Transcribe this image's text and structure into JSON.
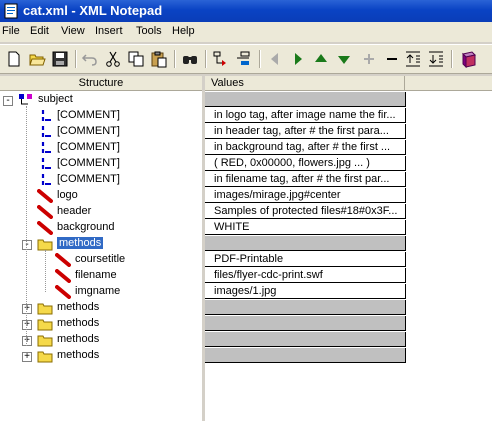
{
  "window": {
    "title": "cat.xml - XML Notepad"
  },
  "menu": [
    "File",
    "Edit",
    "View",
    "Insert",
    "Tools",
    "Help"
  ],
  "toolbar": {
    "buttons": [
      "new-file-icon",
      "open-folder-icon",
      "save-icon",
      "undo-icon",
      "cut-icon",
      "copy-icon",
      "paste-icon",
      "find-icon",
      "insert-child-icon",
      "insert-sibling-icon",
      "move-left-icon",
      "move-right-icon",
      "move-up-icon",
      "move-down-icon",
      "expand-icon",
      "collapse-icon",
      "expand-all-icon",
      "collapse-all-icon",
      "help-book-icon"
    ]
  },
  "structure": {
    "header": "Structure",
    "rows": [
      {
        "label": "subject",
        "type": "root",
        "expander": "-",
        "indent": 0
      },
      {
        "label": "[COMMENT]",
        "type": "comment",
        "indent": 1
      },
      {
        "label": "[COMMENT]",
        "type": "comment",
        "indent": 1
      },
      {
        "label": "[COMMENT]",
        "type": "comment",
        "indent": 1
      },
      {
        "label": "[COMMENT]",
        "type": "comment",
        "indent": 1
      },
      {
        "label": "[COMMENT]",
        "type": "comment",
        "indent": 1
      },
      {
        "label": "logo",
        "type": "attribute",
        "indent": 1
      },
      {
        "label": "header",
        "type": "attribute",
        "indent": 1
      },
      {
        "label": "background",
        "type": "attribute",
        "indent": 1
      },
      {
        "label": "methods",
        "type": "folder",
        "expander": "-",
        "indent": 1,
        "selected": true
      },
      {
        "label": "coursetitle",
        "type": "attribute",
        "indent": 2
      },
      {
        "label": "filename",
        "type": "attribute",
        "indent": 2
      },
      {
        "label": "imgname",
        "type": "attribute",
        "indent": 2
      },
      {
        "label": "methods",
        "type": "folder",
        "expander": "+",
        "indent": 1
      },
      {
        "label": "methods",
        "type": "folder",
        "expander": "+",
        "indent": 1
      },
      {
        "label": "methods",
        "type": "folder",
        "expander": "+",
        "indent": 1
      },
      {
        "label": "methods",
        "type": "folder",
        "expander": "+",
        "indent": 1
      }
    ]
  },
  "values": {
    "header": "Values",
    "rows": [
      "",
      "in logo tag, after image name the fir...",
      "in header tag, after # the first para...",
      "in background tag, after # the first ...",
      "( RED, 0x00000, flowers.jpg ... )",
      "in filename tag, after # the first par...",
      "images/mirage.jpg#center",
      "Samples of protected files#18#0x3F...",
      "WHITE",
      "",
      "PDF-Printable",
      "files/flyer-cdc-print.swf",
      "images/1.jpg",
      "",
      "",
      "",
      ""
    ]
  },
  "colors": {
    "selection": "#316ac5",
    "titlebar": "#0a43c4",
    "attribute_red": "#cc0000",
    "comment_blue": "#0000cc",
    "folder_yellow": "#f5d94a"
  }
}
